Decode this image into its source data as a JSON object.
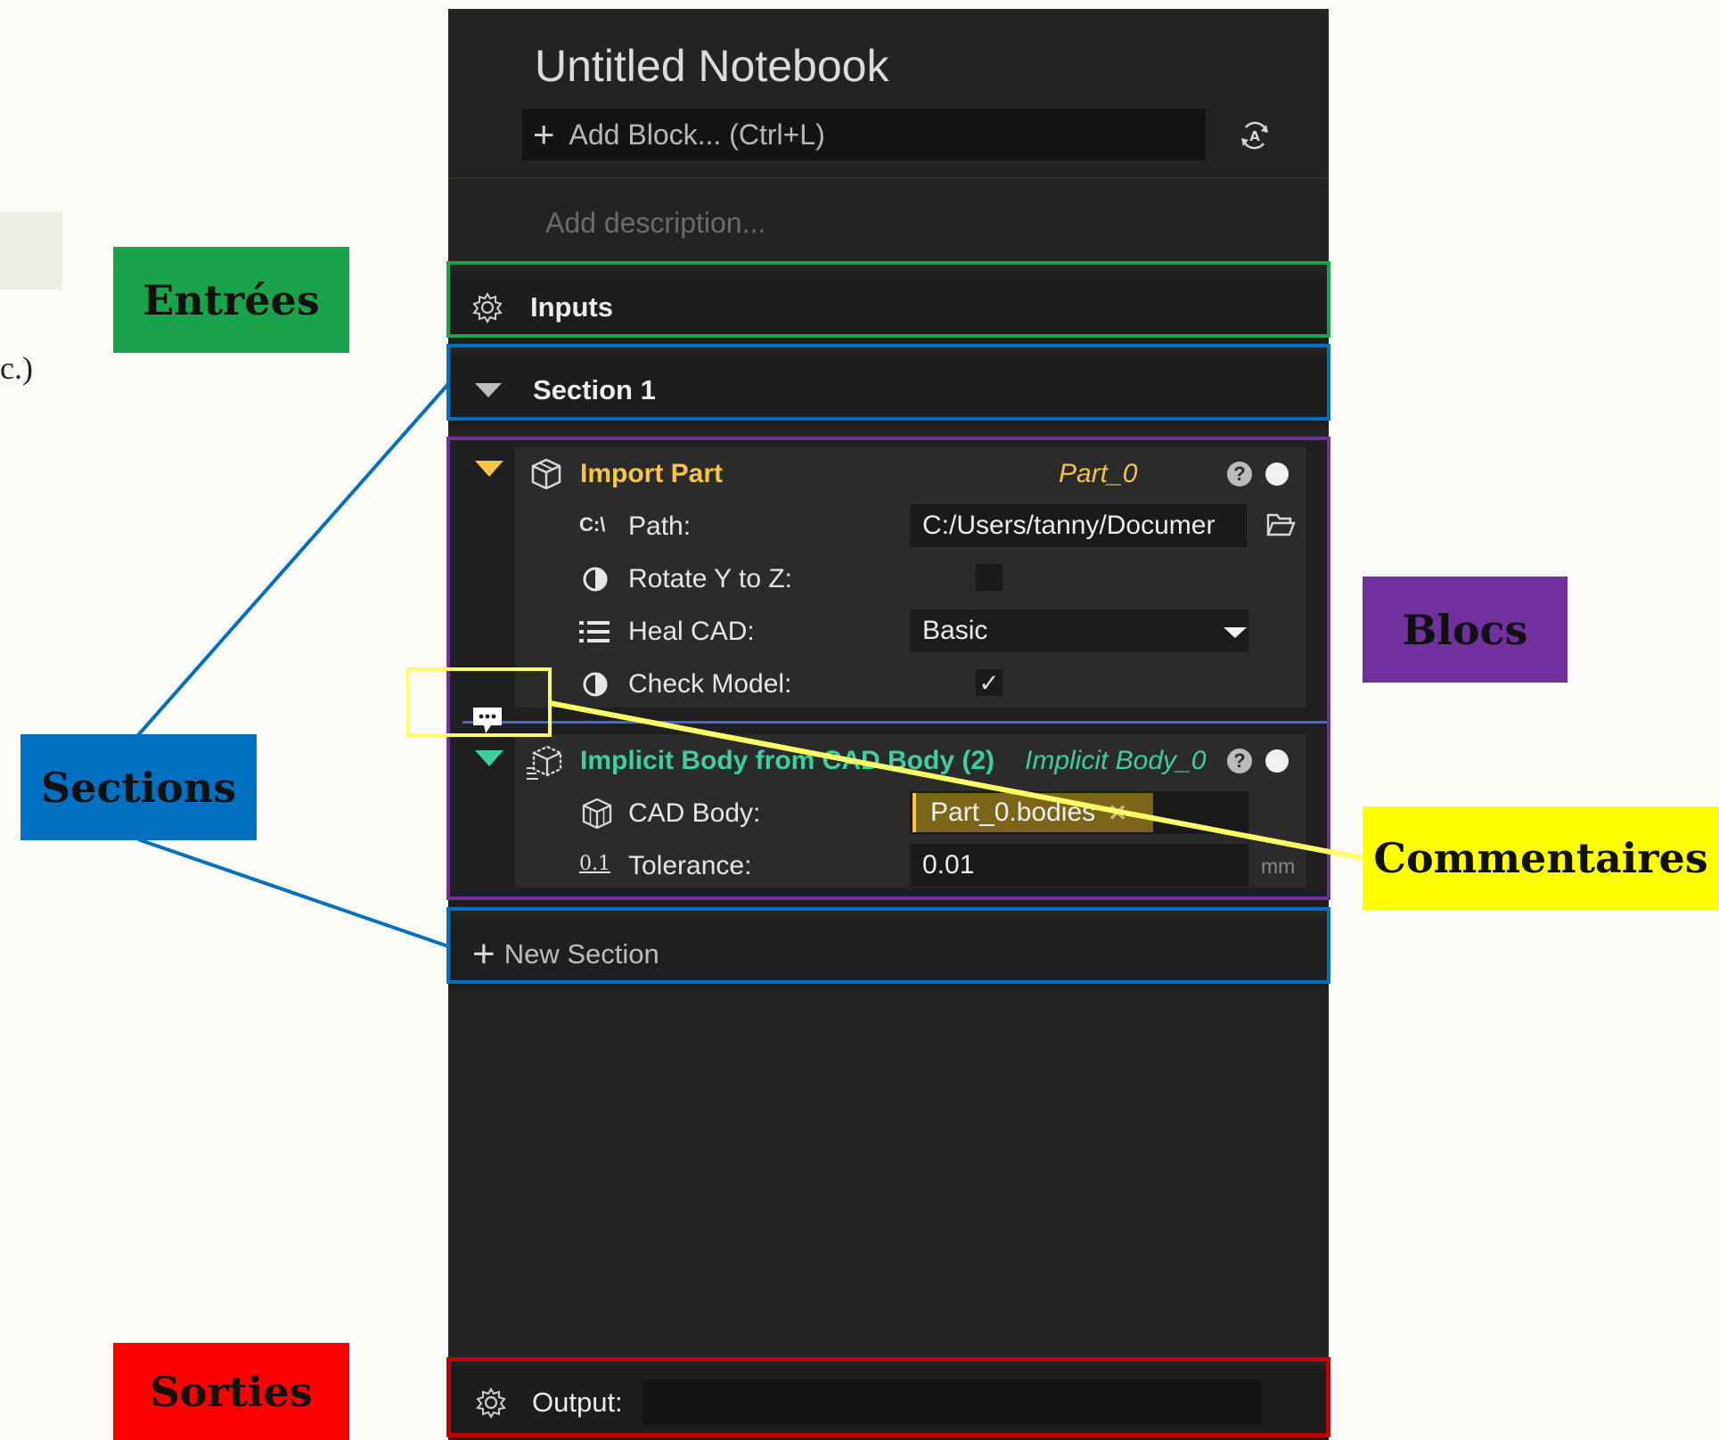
{
  "fragment": {
    "text": "c.)"
  },
  "labels": {
    "entrees": "Entrées",
    "sections": "Sections",
    "sorties": "Sorties",
    "blocs": "Blocs",
    "commentaires": "Commentaires"
  },
  "notebook": {
    "title": "Untitled Notebook",
    "add_block": "Add Block... (Ctrl+L)",
    "description_placeholder": "Add description...",
    "inputs_label": "Inputs",
    "section_label": "Section 1",
    "new_section": "New Section",
    "output_label": "Output:",
    "output_value": ""
  },
  "blocks": [
    {
      "title": "Import Part",
      "variable": "Part_0",
      "help": "?",
      "accent": "#f5c543",
      "params": [
        {
          "icon": "C:\\",
          "label": "Path:",
          "value": "C:/Users/tanny/Documer"
        },
        {
          "label": "Rotate Y to Z:",
          "value": ""
        },
        {
          "label": "Heal CAD:",
          "value": "Basic"
        },
        {
          "label": "Check Model:",
          "value": "✓"
        }
      ]
    },
    {
      "title": "Implicit Body from CAD Body (2)",
      "variable": "Implicit Body_0",
      "help": "?",
      "accent": "#3ecf9c",
      "params": [
        {
          "label": "CAD Body:",
          "value": "Part_0.bodies"
        },
        {
          "icon": "0.1",
          "label": "Tolerance:",
          "value": "0.01",
          "unit": "mm"
        }
      ]
    }
  ],
  "colors": {
    "inputs_outline": "#1aa34a",
    "sections_outline": "#0070c0",
    "blocks_outline": "#7030a0",
    "comment_outline": "#ffff66",
    "output_outline": "#c00000"
  }
}
